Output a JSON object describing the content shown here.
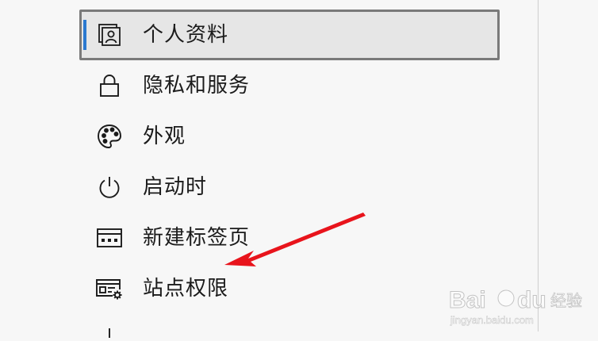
{
  "menu": {
    "items": [
      {
        "label": "个人资料",
        "icon": "profile-icon",
        "selected": true
      },
      {
        "label": "隐私和服务",
        "icon": "lock-icon"
      },
      {
        "label": "外观",
        "icon": "palette-icon"
      },
      {
        "label": "启动时",
        "icon": "power-icon"
      },
      {
        "label": "新建标签页",
        "icon": "new-tab-icon"
      },
      {
        "label": "站点权限",
        "icon": "site-permissions-icon"
      }
    ]
  },
  "colors": {
    "accent": "#2b79d0",
    "arrow": "#e8141c",
    "selected_bg": "#e6e6e6",
    "selected_border": "#7a7a7a",
    "page_bg": "#f7f7f7"
  }
}
